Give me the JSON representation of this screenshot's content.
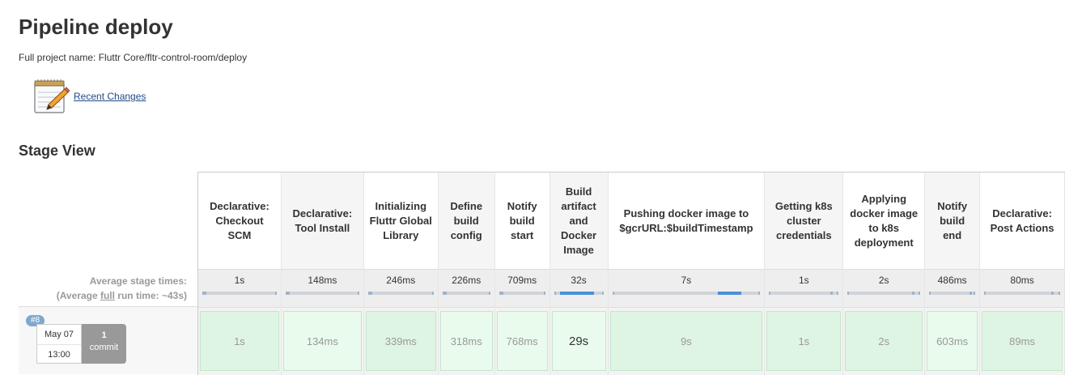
{
  "page": {
    "title": "Pipeline deploy",
    "full_name": "Full project name: Fluttr Core/fltr-control-room/deploy"
  },
  "recent_changes": {
    "label": "Recent Changes",
    "icon": "notepad-pencil-icon"
  },
  "stage_view": {
    "title": "Stage View",
    "avg_label_line1": "Average stage times:",
    "avg_label_prefix": "(Average ",
    "avg_label_full": "full",
    "avg_label_suffix": " run time: ~43s)",
    "stages": [
      {
        "name": "Declarative: Checkout SCM",
        "avg": "1s",
        "run": "1s",
        "bar_fraction": 0.03
      },
      {
        "name": "Declarative: Tool Install",
        "avg": "148ms",
        "run": "134ms",
        "bar_fraction": 0.01
      },
      {
        "name": "Initializing Fluttr Global Library",
        "avg": "246ms",
        "run": "339ms",
        "bar_fraction": 0.01
      },
      {
        "name": "Define build config",
        "avg": "226ms",
        "run": "318ms",
        "bar_fraction": 0.01
      },
      {
        "name": "Notify build start",
        "avg": "709ms",
        "run": "768ms",
        "bar_fraction": 0.02
      },
      {
        "name": "Build artifact and Docker Image",
        "avg": "32s",
        "run": "29s",
        "bar_fraction": 0.74
      },
      {
        "name": "Pushing docker image to $gcrURL:$buildTimestamp",
        "avg": "7s",
        "run": "9s",
        "bar_fraction": 0.16
      },
      {
        "name": "Getting k8s cluster credentials",
        "avg": "1s",
        "run": "1s",
        "bar_fraction": 0.03
      },
      {
        "name": "Applying docker image to k8s deployment",
        "avg": "2s",
        "run": "2s",
        "bar_fraction": 0.05
      },
      {
        "name": "Notify build end",
        "avg": "486ms",
        "run": "603ms",
        "bar_fraction": 0.01
      },
      {
        "name": "Declarative: Post Actions",
        "avg": "80ms",
        "run": "89ms",
        "bar_fraction": 0.01
      }
    ]
  },
  "build": {
    "number": "#8",
    "date": "May 07",
    "time": "13:00",
    "commit_count": "1",
    "commit_label": "commit"
  },
  "colors": {
    "stage_success": "#dff5e3",
    "bar_fill": "#4a90d9",
    "link": "#204a87",
    "badge": "#7fa8d1",
    "commit_box": "#999999"
  }
}
